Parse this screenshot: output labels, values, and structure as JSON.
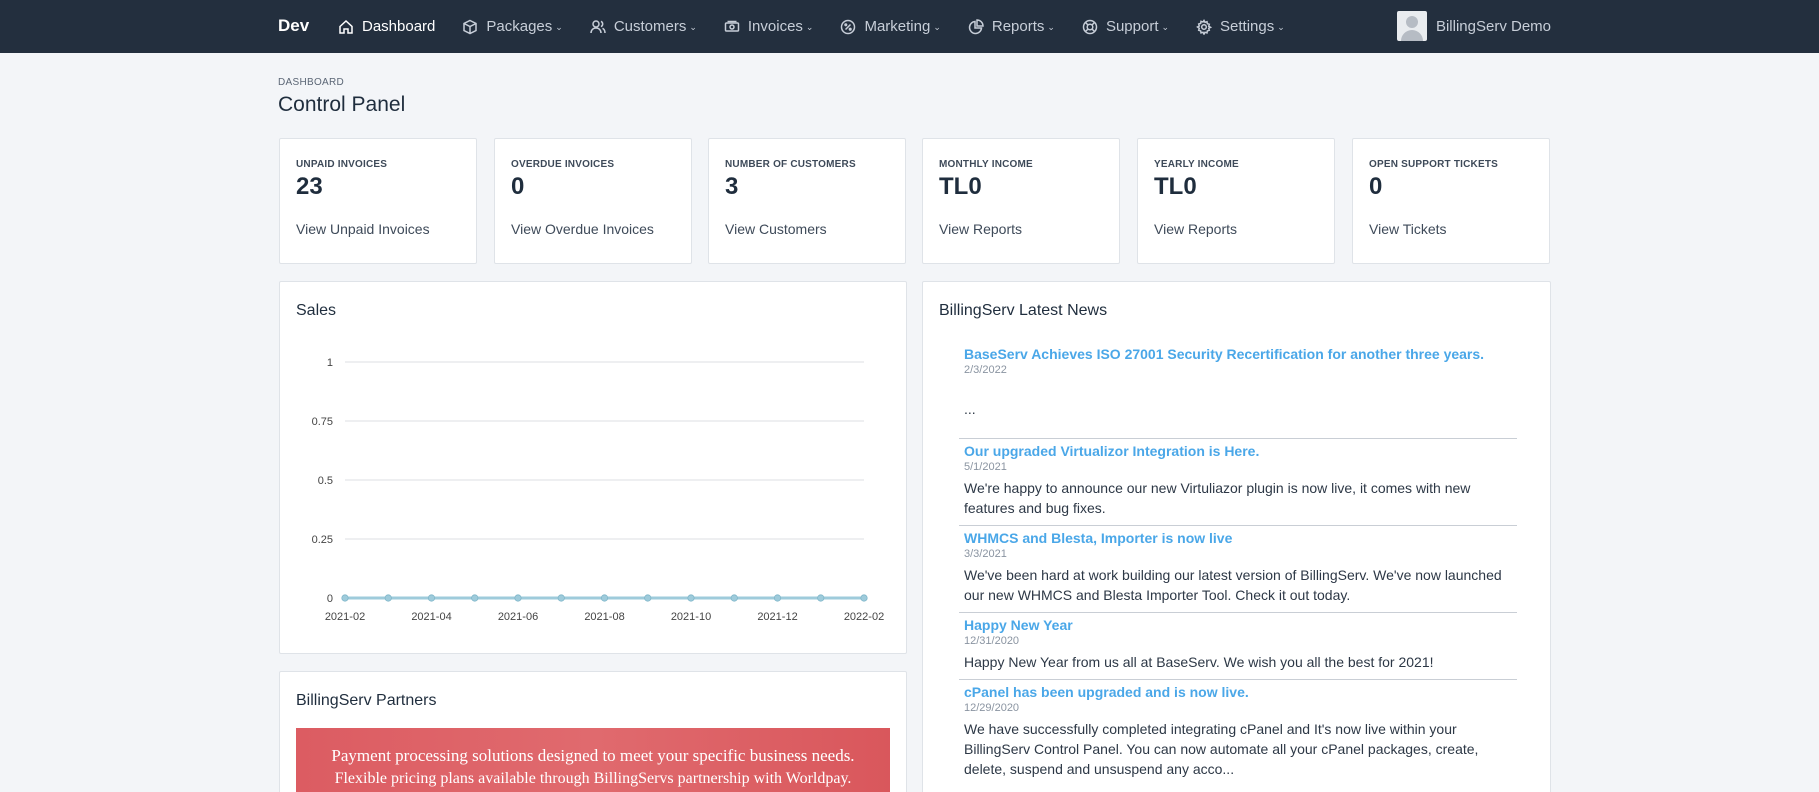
{
  "brand": "Dev",
  "nav": [
    {
      "label": "Dashboard",
      "icon": "home-icon"
    },
    {
      "label": "Packages",
      "icon": "box-icon"
    },
    {
      "label": "Customers",
      "icon": "users-icon"
    },
    {
      "label": "Invoices",
      "icon": "money-icon"
    },
    {
      "label": "Marketing",
      "icon": "percent-icon"
    },
    {
      "label": "Reports",
      "icon": "pie-chart-icon"
    },
    {
      "label": "Support",
      "icon": "lifebuoy-icon"
    },
    {
      "label": "Settings",
      "icon": "gear-icon"
    }
  ],
  "user": {
    "name": "BillingServ Demo"
  },
  "header": {
    "breadcrumb": "DASHBOARD",
    "title": "Control Panel"
  },
  "stats": [
    {
      "label": "UNPAID INVOICES",
      "value": "23",
      "link": "View Unpaid Invoices"
    },
    {
      "label": "OVERDUE INVOICES",
      "value": "0",
      "link": "View Overdue Invoices"
    },
    {
      "label": "NUMBER OF CUSTOMERS",
      "value": "3",
      "link": "View Customers"
    },
    {
      "label": "MONTHLY INCOME",
      "value": "TL0",
      "link": "View Reports"
    },
    {
      "label": "YEARLY INCOME",
      "value": "TL0",
      "link": "View Reports"
    },
    {
      "label": "OPEN SUPPORT TICKETS",
      "value": "0",
      "link": "View Tickets"
    }
  ],
  "sales": {
    "title": "Sales"
  },
  "chart_data": {
    "type": "line",
    "title": "Sales",
    "x": [
      "2021-02",
      "2021-03",
      "2021-04",
      "2021-05",
      "2021-06",
      "2021-07",
      "2021-08",
      "2021-09",
      "2021-10",
      "2021-11",
      "2021-12",
      "2022-01",
      "2022-02"
    ],
    "x_tick_labels": [
      "2021-02",
      "2021-04",
      "2021-06",
      "2021-08",
      "2021-10",
      "2021-12",
      "2022-02"
    ],
    "series": [
      {
        "values": [
          0,
          0,
          0,
          0,
          0,
          0,
          0,
          0,
          0,
          0,
          0,
          0,
          0
        ]
      }
    ],
    "y_ticks": [
      "0",
      "0.25",
      "0.5",
      "0.75",
      "1"
    ],
    "ylim": [
      0,
      1
    ],
    "grid": true,
    "line_color": "#9ecbdb"
  },
  "news": {
    "title": "BillingServ Latest News",
    "items": [
      {
        "title": "BaseServ Achieves ISO 27001 Security Recertification for another three years.",
        "date": "2/3/2022",
        "body": "..."
      },
      {
        "title": "Our upgraded Virtualizor Integration is Here.",
        "date": "5/1/2021",
        "body": "We're happy to announce our new Virtuliazor plugin is now live, it comes with new features and bug fixes."
      },
      {
        "title": "WHMCS and Blesta, Importer is now live",
        "date": "3/3/2021",
        "body": "We've been hard at work building our latest version of BillingServ. We've now launched our new WHMCS and Blesta Importer Tool. Check it out today."
      },
      {
        "title": "Happy New Year",
        "date": "12/31/2020",
        "body": "Happy New Year from us all at BaseServ. We wish you all the best for 2021!"
      },
      {
        "title": "cPanel has been upgraded and is now live.",
        "date": "12/29/2020",
        "body": "We have successfully completed integrating cPanel and It's now live within your BillingServ Control Panel. You can now automate all your cPanel packages, create, delete, suspend and unsuspend any acco..."
      }
    ]
  },
  "partners": {
    "title": "BillingServ Partners",
    "banner_line1": "Payment processing solutions designed to meet your specific business needs.",
    "banner_line2": "Flexible pricing plans available through BillingServs partnership with Worldpay."
  },
  "colors": {
    "topbar": "#232f3e",
    "link": "#4aa7e8",
    "background": "#f3f5f8"
  }
}
